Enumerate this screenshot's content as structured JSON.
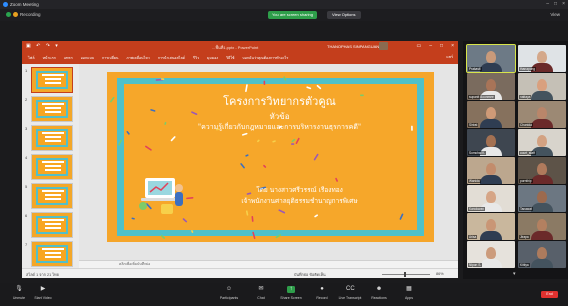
{
  "zoom": {
    "window_title": "Zoom Meeting",
    "recording_label": "Recording",
    "share_banner": "You are screen sharing",
    "share_options": "View Options",
    "view_label": "View"
  },
  "ppt": {
    "doc_title": "...พื้นที่1.pptx  -  PowerPoint",
    "user_name": "THANOPHAS SINPANGUAN",
    "ribbon_tabs": [
      "ไฟล์",
      "หน้าแรก",
      "แทรก",
      "ออกแบบ",
      "การเปลี่ยน",
      "ภาพเคลื่อนไหว",
      "การนำเสนอสไลด์",
      "รีวิว",
      "มุมมอง",
      "วิธีใช้",
      "บอกฉันว่าคุณต้องการทำอะไร"
    ],
    "share_label": "แชร์",
    "thumbnails": [
      {
        "num": "1",
        "selected": true
      },
      {
        "num": "2",
        "selected": false
      },
      {
        "num": "3",
        "selected": false
      },
      {
        "num": "4",
        "selected": false
      },
      {
        "num": "5",
        "selected": false
      },
      {
        "num": "6",
        "selected": false
      },
      {
        "num": "7",
        "selected": false
      }
    ],
    "notes_placeholder": "คลิกเพื่อเพิ่มบันทึกย่อ",
    "status_left": "สไลด์ 1 จาก 21   ไทย",
    "status_right": "บันทึกย่อ   ข้อคิดเห็น",
    "zoom_value": "86%"
  },
  "slide": {
    "title": "โครงการวิทยากรตัวคูณ",
    "topic_label": "หัวข้อ",
    "topic": "\"ความรู้เกี่ยวกับกฎหมายและการบริหารงานธุรการคดี\"",
    "speaker": "โดย นางสาวศรีวรรณ์ เรืองทอง",
    "position": "เจ้าพนักงานศาลยุติธรรมชำนาญการพิเศษ"
  },
  "gallery": {
    "tiles": [
      {
        "name": "Prakasit",
        "skin": "#c99a7a",
        "bg": "#6d7a86",
        "active": true
      },
      {
        "name": "thanapong",
        "skin": "#d4a88a",
        "bg": "#dfe3e6",
        "active": false
      },
      {
        "name": "supanit Boonmee",
        "skin": "#a87458",
        "bg": "#7a6b5e",
        "active": false
      },
      {
        "name": "nattaya",
        "skin": "#d9a07e",
        "bg": "#c5c0b6",
        "active": false
      },
      {
        "name": "Sirirat",
        "skin": "#cf9a77",
        "bg": "#86715d",
        "active": false
      },
      {
        "name": "Chanida",
        "skin": "#b9866a",
        "bg": "#9c8974",
        "active": false
      },
      {
        "name": "Somchai K.",
        "skin": "#a47152",
        "bg": "#3e4650",
        "active": false
      },
      {
        "name": "court_staff",
        "skin": "#d3a282",
        "bg": "#d8d4cc",
        "active": false
      },
      {
        "name": "Wanida",
        "skin": "#c28c6c",
        "bg": "#bca78e",
        "active": false
      },
      {
        "name": "pornthip",
        "skin": "#b07a5c",
        "bg": "#5d5348",
        "active": false
      },
      {
        "name": "Kanokwan",
        "skin": "#d6a586",
        "bg": "#e2ddd5",
        "active": false
      },
      {
        "name": "Tanawat",
        "skin": "#9c6a4e",
        "bg": "#6c7782",
        "active": false
      },
      {
        "name": "Arisa",
        "skin": "#c99676",
        "bg": "#c9b79d",
        "active": false
      },
      {
        "name": "Jirapa",
        "skin": "#b38060",
        "bg": "#8b7a64",
        "active": false
      },
      {
        "name": "Nipon S.",
        "skin": "#cc9b7b",
        "bg": "#e6e2dc",
        "active": false
      },
      {
        "name": "Kittiya",
        "skin": "#ad7b5d",
        "bg": "#58606a",
        "active": false
      }
    ],
    "more_label": "▾"
  },
  "toolbar": {
    "buttons": [
      {
        "label": "Unmute",
        "icon": "mic-icon"
      },
      {
        "label": "Start Video",
        "icon": "video-icon"
      },
      {
        "label": "Participants",
        "icon": "participants-icon"
      },
      {
        "label": "Chat",
        "icon": "chat-icon"
      },
      {
        "label": "Share Screen",
        "icon": "share-icon"
      },
      {
        "label": "Record",
        "icon": "record-icon"
      },
      {
        "label": "Live Transcript",
        "icon": "cc-icon"
      },
      {
        "label": "Reactions",
        "icon": "reactions-icon"
      },
      {
        "label": "Apps",
        "icon": "apps-icon"
      }
    ],
    "end_label": "End"
  },
  "colors": {
    "ppt_accent": "#c43e1c",
    "slide_orange": "#f6a72a",
    "slide_teal": "#4fc1c9",
    "zoom_green": "#2e9e4a",
    "end_red": "#e0312f"
  }
}
